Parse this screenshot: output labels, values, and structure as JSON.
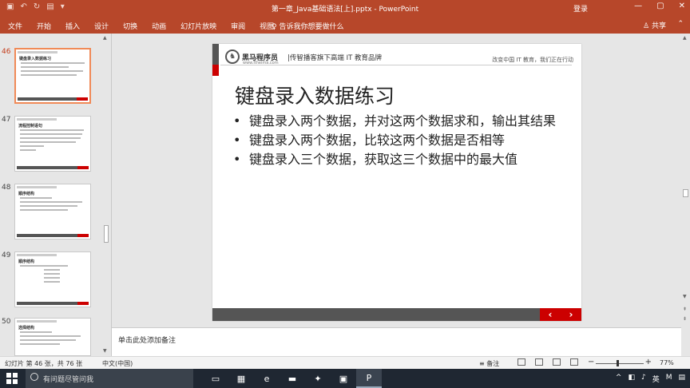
{
  "titlebar": {
    "title": "第一章_Java基础语法[上].pptx - PowerPoint",
    "login": "登录",
    "minimize": "—",
    "restore": "▢",
    "close": "✕"
  },
  "ribbon": {
    "tabs": [
      "文件",
      "开始",
      "插入",
      "设计",
      "切换",
      "动画",
      "幻灯片放映",
      "审阅",
      "视图"
    ],
    "tell_me": "告诉我你想要做什么",
    "share": "共享"
  },
  "thumbnails": [
    {
      "num": "46",
      "title": "键盘录入数据练习",
      "active": true
    },
    {
      "num": "47",
      "title": "流程控制语句",
      "active": false
    },
    {
      "num": "48",
      "title": "顺序结构",
      "active": false
    },
    {
      "num": "49",
      "title": "顺序结构",
      "active": false
    },
    {
      "num": "50",
      "title": "选择结构",
      "active": false
    }
  ],
  "slide": {
    "brand_name": "黑马程序员",
    "brand_url": "www.itheima.com",
    "tagline": "|传智播客旗下高端 IT 教育品牌",
    "right_text": "改变中国 IT 教育，我们正在行动",
    "heading": "键盘录入数据练习",
    "bullets": [
      "键盘录入两个数据，并对这两个数据求和，输出其结果",
      "键盘录入两个数据，比较这两个数据是否相等",
      "键盘录入三个数据，获取这三个数据中的最大值"
    ],
    "prev": "‹",
    "next": "›"
  },
  "notes": {
    "placeholder": "单击此处添加备注"
  },
  "status": {
    "slide_info": "幻灯片 第 46 张，共 76 张",
    "language": "中文(中国)",
    "notes_button": "备注",
    "zoom": "77%"
  },
  "taskbar": {
    "search_placeholder": "有问题尽管问我",
    "tray_lang": "英",
    "tray_m": "M"
  }
}
